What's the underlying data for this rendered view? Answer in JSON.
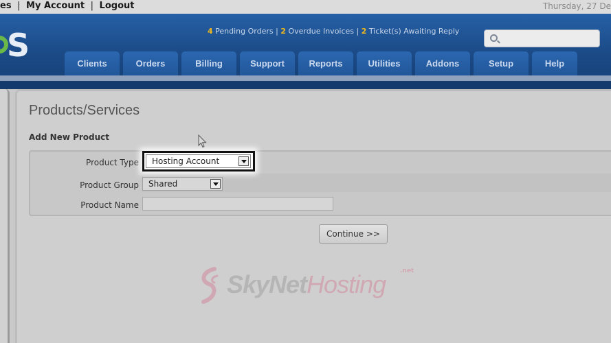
{
  "topbar": {
    "links": [
      "es",
      "My Account",
      "Logout"
    ],
    "date": "Thursday, 27 De"
  },
  "header": {
    "logo_letter": "S",
    "alerts": {
      "pending_orders_count": "4",
      "pending_orders_label": " Pending Orders",
      "sep1": " | ",
      "overdue_count": "2",
      "overdue_label": " Overdue Invoices",
      "sep2": " | ",
      "tickets_count": "2",
      "tickets_label": " Ticket(s) Awaiting Reply"
    },
    "search": {
      "value": "",
      "placeholder": ""
    },
    "nav": [
      "Clients",
      "Orders",
      "Billing",
      "Support",
      "Reports",
      "Utilities",
      "Addons",
      "Setup",
      "Help"
    ]
  },
  "main": {
    "page_title": "Products/Services",
    "section_title": "Add New Product",
    "form": {
      "product_type_label": "Product Type",
      "product_type_value": "Hosting Account",
      "product_group_label": "Product Group",
      "product_group_value": "Shared",
      "product_name_label": "Product Name",
      "product_name_value": ""
    },
    "continue_label": "Continue >>"
  },
  "watermark": {
    "part1": "SkyNet",
    "part2": "Hosting",
    "suffix": ".net"
  },
  "colors": {
    "header_blue": "#1b4a86",
    "alert_number": "#f1b81c",
    "logo_gear": "#6bb84a"
  }
}
